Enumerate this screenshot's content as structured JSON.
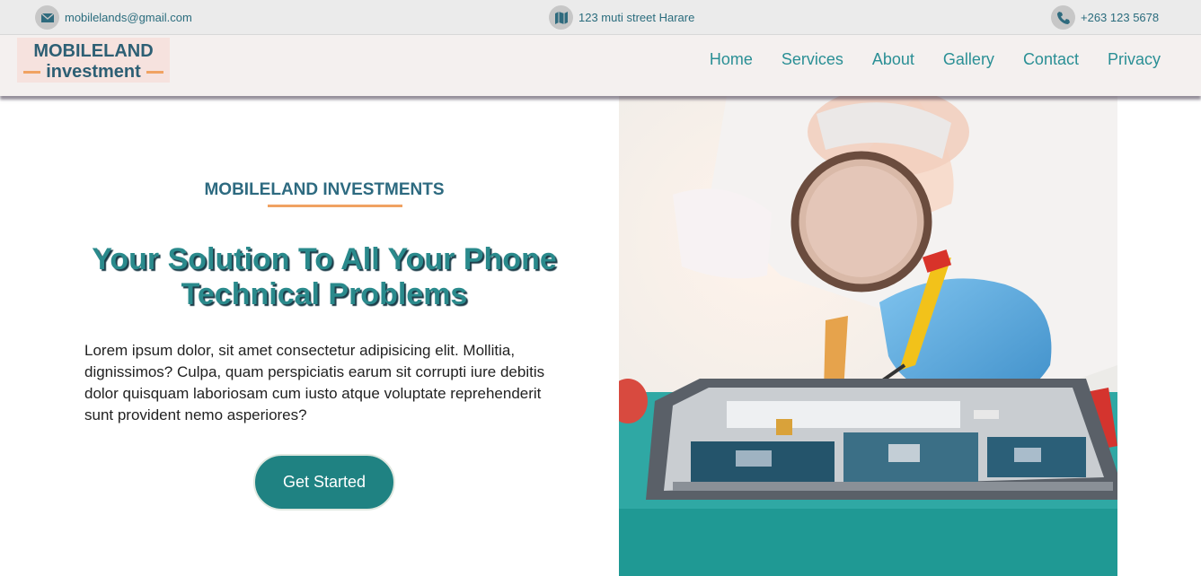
{
  "topbar": {
    "email": "mobilelands@gmail.com",
    "address": "123 muti street Harare",
    "phone": "+263 123 5678",
    "icons": {
      "email": "envelope-icon",
      "address": "map-icon",
      "phone": "phone-icon"
    }
  },
  "logo": {
    "line1": "MOBILELAND",
    "line2": "investment"
  },
  "nav": {
    "items": [
      "Home",
      "Services",
      "About",
      "Gallery",
      "Contact",
      "Privacy"
    ]
  },
  "hero": {
    "kicker": "MOBILELAND INVESTMENTS",
    "headline": "Your Solution To All Your Phone Technical Problems",
    "paragraph": "Lorem ipsum dolor, sit amet consectetur adipisicing elit. Mollitia, dignissimos? Culpa, quam perspiciatis earum sit corrupti iure debitis dolor quisquam laboriosam cum iusto atque voluptate reprehenderit sunt provident nemo asperiores?",
    "cta_label": "Get Started"
  },
  "colors": {
    "accent": "#f0a262",
    "brand": "#2d5f74",
    "teal": "#1f8282",
    "nav_link": "#2a8f95"
  }
}
